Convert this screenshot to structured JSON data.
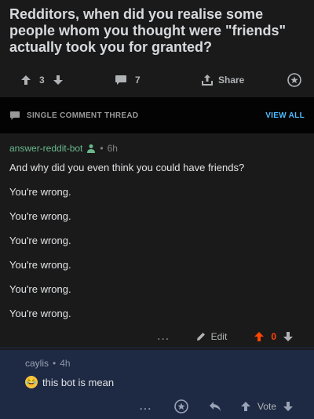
{
  "post": {
    "title": "Redditors, when did you realise some people whom you thought were \"friends\" actually took you for granted?",
    "vote_count": "3",
    "comment_count": "7",
    "share_label": "Share"
  },
  "thread_bar": {
    "label": "SINGLE COMMENT THREAD",
    "view_all": "VIEW ALL"
  },
  "comment": {
    "author": "answer-reddit-bot",
    "separator": "•",
    "time": "6h",
    "paragraphs": [
      "And why did you even think you could have friends?",
      "You're wrong.",
      "You're wrong.",
      "You're wrong.",
      "You're wrong.",
      "You're wrong.",
      "You're wrong."
    ],
    "more": "...",
    "edit_label": "Edit",
    "vote_count": "0"
  },
  "reply": {
    "author": "caylis",
    "separator": "•",
    "time": "4h",
    "emoji": "😂",
    "text": "this bot is mean",
    "more": "...",
    "vote_label": "Vote"
  },
  "colors": {
    "background": "#1a1a1b",
    "author_green": "#6ab78c",
    "upvote_orange": "#ff4500",
    "link_blue": "#4fbcff",
    "reply_bg": "#1e2a44"
  }
}
